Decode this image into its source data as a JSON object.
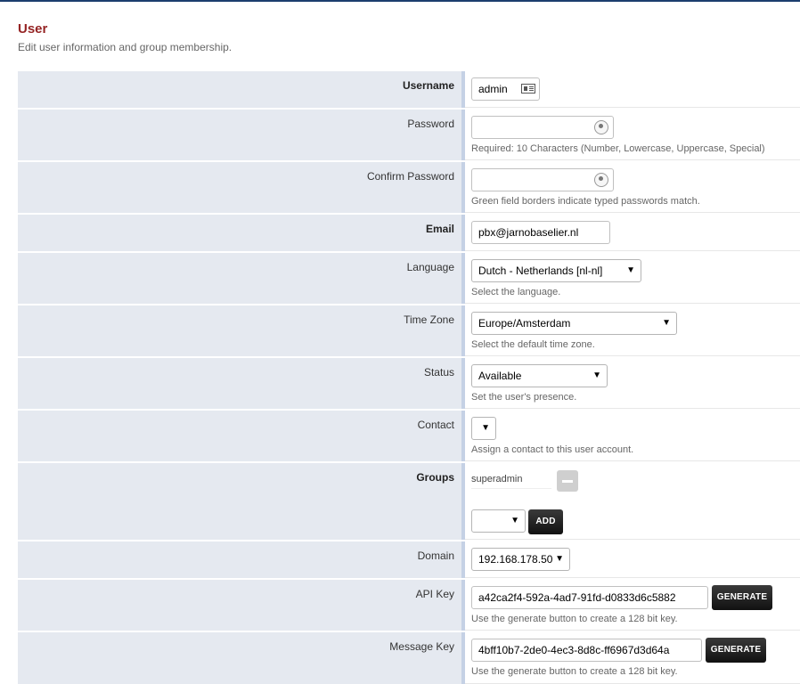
{
  "header": {
    "title": "User",
    "subtitle": "Edit user information and group membership."
  },
  "fields": {
    "username": {
      "label": "Username",
      "value": "admin"
    },
    "password": {
      "label": "Password",
      "value": "",
      "description": "Required: 10 Characters (Number, Lowercase, Uppercase, Special)"
    },
    "confirm_password": {
      "label": "Confirm Password",
      "value": "",
      "description": "Green field borders indicate typed passwords match."
    },
    "email": {
      "label": "Email",
      "value": "pbx@jarnobaselier.nl"
    },
    "language": {
      "label": "Language",
      "value": "Dutch - Netherlands [nl-nl]",
      "description": "Select the language."
    },
    "time_zone": {
      "label": "Time Zone",
      "value": "Europe/Amsterdam",
      "description": "Select the default time zone."
    },
    "status": {
      "label": "Status",
      "value": "Available",
      "description": "Set the user's presence."
    },
    "contact": {
      "label": "Contact",
      "value": "",
      "description": "Assign a contact to this user account."
    },
    "groups": {
      "label": "Groups",
      "items": [
        "superadmin"
      ],
      "select_value": "",
      "add_label": "ADD"
    },
    "domain": {
      "label": "Domain",
      "value": "192.168.178.50"
    },
    "api_key": {
      "label": "API Key",
      "value": "a42ca2f4-592a-4ad7-91fd-d0833d6c5882",
      "button": "GENERATE",
      "description": "Use the generate button to create a 128 bit key."
    },
    "message_key": {
      "label": "Message Key",
      "value": "4bff10b7-2de0-4ec3-8d8c-ff6967d3d64a",
      "button": "GENERATE",
      "description": "Use the generate button to create a 128 bit key."
    }
  },
  "colors": {
    "title": "#952424",
    "label_bg": "#e5e9f0",
    "label_border": "#c5d1e5",
    "button_bg": "#111111"
  },
  "icons": {
    "username": "contact-card-icon",
    "password": "password-visibility-icon",
    "group_remove": "minus-icon"
  }
}
